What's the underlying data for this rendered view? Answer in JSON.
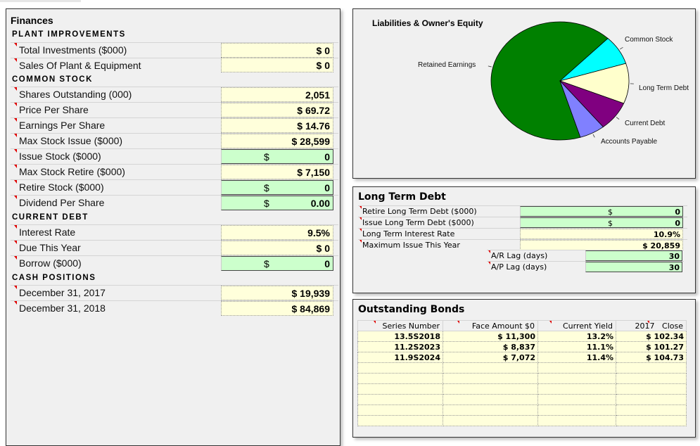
{
  "finances": {
    "title": "Finances",
    "sections": {
      "plant": "PLANT IMPROVEMENTS",
      "stock": "COMMON STOCK",
      "debt": "CURRENT DEBT",
      "cash": "CASH POSITIONS"
    },
    "rows": {
      "total_investments": {
        "label": "Total Investments ($000)",
        "value": "$ 0"
      },
      "sales_plant": {
        "label": "Sales Of Plant & Equipment",
        "value": "$ 0"
      },
      "shares_outstanding": {
        "label": "Shares Outstanding (000)",
        "value": "2,051"
      },
      "price_per_share": {
        "label": "Price Per Share",
        "value": "$ 69.72"
      },
      "eps": {
        "label": "Earnings Per Share",
        "value": "$ 14.76"
      },
      "max_stock_issue": {
        "label": "Max Stock Issue ($000)",
        "value": "$ 28,599"
      },
      "issue_stock": {
        "label": "Issue Stock ($000)",
        "currency": "$",
        "value": "0"
      },
      "max_stock_retire": {
        "label": "Max Stock Retire ($000)",
        "value": "$ 7,150"
      },
      "retire_stock": {
        "label": "Retire Stock ($000)",
        "currency": "$",
        "value": "0"
      },
      "dividend": {
        "label": "Dividend Per Share",
        "currency": "$",
        "value": "0.00"
      },
      "interest_rate": {
        "label": "Interest Rate",
        "value": "9.5%"
      },
      "due_this_year": {
        "label": "Due This Year",
        "value": "$ 0"
      },
      "borrow": {
        "label": "Borrow ($000)",
        "currency": "$",
        "value": "0"
      },
      "dec2017": {
        "label": "December 31, 2017",
        "value": "$ 19,939"
      },
      "dec2018": {
        "label": "December 31, 2018",
        "value": "$ 84,869"
      }
    }
  },
  "chart_data": {
    "type": "pie",
    "title": "Liabilities & Owner's Equity",
    "categories": [
      "Retained Earnings",
      "Common Stock",
      "Long Term Debt",
      "Current Debt",
      "Accounts Payable"
    ],
    "values": [
      67,
      8,
      11,
      8,
      6
    ],
    "colors": [
      "#008000",
      "#00ffff",
      "#ffffcc",
      "#800080",
      "#8080ff"
    ],
    "legend": "none (leader-line labels)"
  },
  "long_term_debt": {
    "title": "Long Term Debt",
    "retire": {
      "label": "Retire Long Term Debt ($000)",
      "currency": "$",
      "value": "0"
    },
    "issue": {
      "label": "Issue Long Term Debt ($000)",
      "currency": "$",
      "value": "0"
    },
    "rate": {
      "label": "Long Term Interest Rate",
      "value": "10.9%"
    },
    "max_issue": {
      "label": "Maximum Issue This Year",
      "value": "$ 20,859"
    },
    "ar_lag": {
      "label": "A/R Lag (days)",
      "value": "30"
    },
    "ap_lag": {
      "label": "A/P Lag (days)",
      "value": "30"
    }
  },
  "bonds": {
    "title": "Outstanding Bonds",
    "headers": [
      "Series Number",
      "Face Amount $0",
      "Current Yield",
      "2017",
      "Close"
    ],
    "rows": [
      [
        "13.5S2018",
        "$ 11,300",
        "13.2%",
        "$ 102.34"
      ],
      [
        "11.2S2023",
        "$ 8,837",
        "11.1%",
        "$ 101.27"
      ],
      [
        "11.9S2024",
        "$ 7,072",
        "11.4%",
        "$ 104.73"
      ],
      [
        "",
        "",
        "",
        ""
      ],
      [
        "",
        "",
        "",
        ""
      ],
      [
        "",
        "",
        "",
        ""
      ],
      [
        "",
        "",
        "",
        ""
      ],
      [
        "",
        "",
        "",
        ""
      ],
      [
        "",
        "",
        "",
        ""
      ]
    ]
  }
}
